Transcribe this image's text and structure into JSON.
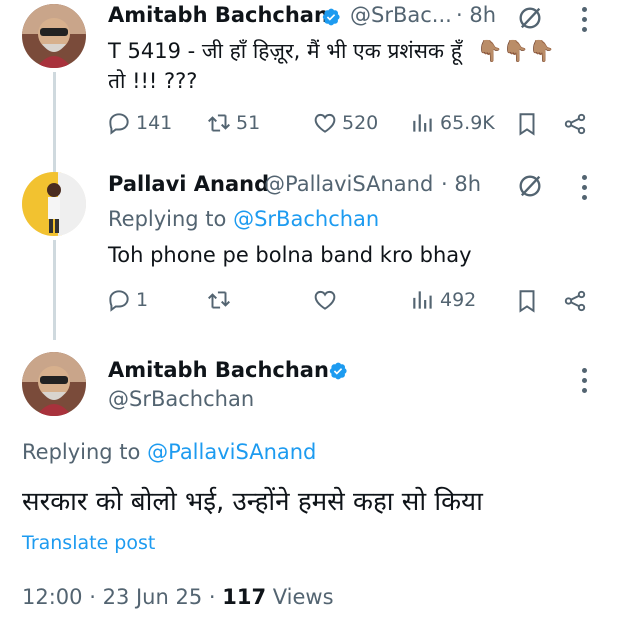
{
  "tweet1": {
    "name": "Amitabh Bachchan",
    "handle": "@SrBac...",
    "time": "· 8h",
    "text_line1": "T 5419 - जी हाँ हिज़ूर, मैं भी एक प्रशंसक हूँ",
    "emoji": "👇🏽👇🏽👇🏽",
    "text_line2": "तो !!! ???",
    "replies": "141",
    "retweets": "51",
    "likes": "520",
    "views": "65.9K"
  },
  "tweet2": {
    "name": "Pallavi Anand",
    "handle": "@PallaviSAnand",
    "time": "· 8h",
    "replying_label": "Replying to",
    "replying_handle": "@SrBachchan",
    "text": "Toh phone pe bolna band kro bhay",
    "replies": "1",
    "views": "492"
  },
  "main_tweet": {
    "name": "Amitabh Bachchan",
    "handle": "@SrBachchan",
    "replying_label": "Replying to",
    "replying_handle": "@PallaviSAnand",
    "text": "सरकार को बोलो भई, उन्होंने हमसे कहा सो किया",
    "translate": "Translate post",
    "time": "12:00",
    "date": "23 Jun 25",
    "views_count": "117",
    "views_label": "Views"
  },
  "colors": {
    "accent": "#1d9bf0",
    "muted": "#536471",
    "text": "#0f1419",
    "thread": "#cfd9de"
  },
  "icons": [
    "verified-badge-icon",
    "grok-icon",
    "more-icon",
    "reply-icon",
    "retweet-icon",
    "like-icon",
    "views-icon",
    "bookmark-icon",
    "share-icon"
  ]
}
